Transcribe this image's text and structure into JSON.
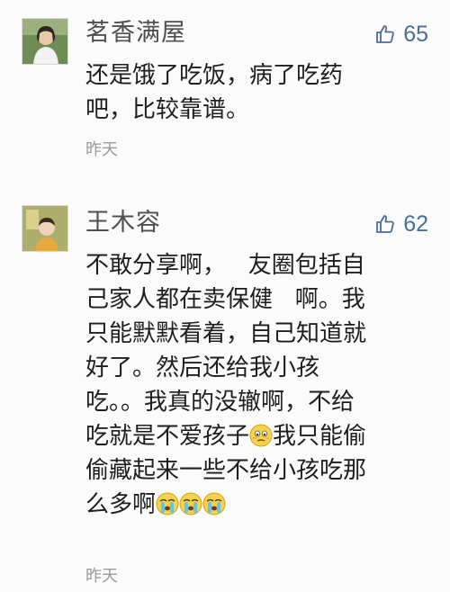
{
  "comments": [
    {
      "username": "茗香满屋",
      "likes": "65",
      "lines": [
        "还是饿了吃饭，病了吃药",
        "吧，比较靠谱。"
      ],
      "time": "昨天",
      "avatar_icon": "user-avatar-woman-photo"
    },
    {
      "username": "王木容",
      "likes": "62",
      "lines": [
        "不敢分享啊，   友圈包括自",
        "己家人都在卖保健   啊。我",
        "只能默默看着，自己知道就",
        "好了。然后还给我小孩",
        "吃。。我真的没辙啊，不给",
        "吃就是不爱孩子",
        "我只能偷",
        "偷藏起来一些不给小孩吃那",
        "么多啊"
      ],
      "time": "昨天",
      "avatar_icon": "user-avatar-child-photo"
    }
  ],
  "icons": {
    "like": "thumbs-up-icon",
    "awkward_emoji": "awkward-face-emoji",
    "crying_emoji": "crying-face-emoji"
  },
  "colors": {
    "background": "#fbfbfb",
    "username": "#4f4f4f",
    "like_accent": "#4a6e9a",
    "time": "#9a9a9a"
  }
}
